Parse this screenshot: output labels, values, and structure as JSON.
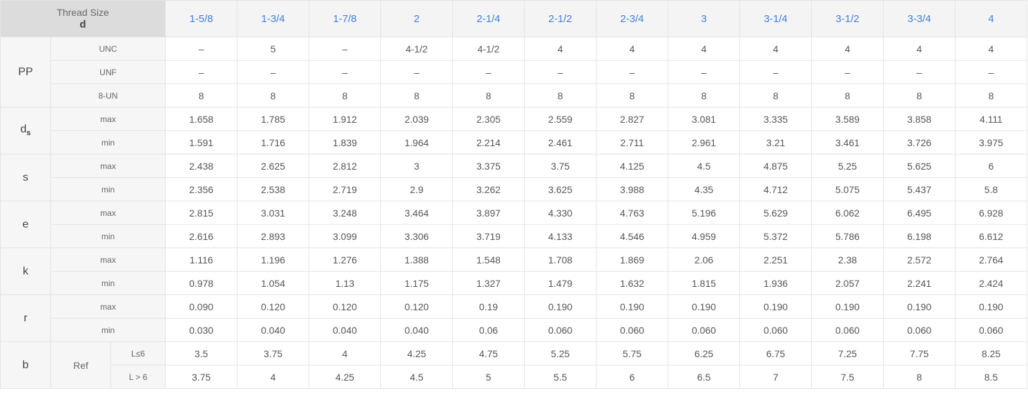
{
  "header": {
    "corner_label": "Thread Size",
    "corner_symbol": "d",
    "sizes": [
      "1-5/8",
      "1-3/4",
      "1-7/8",
      "2",
      "2-1/4",
      "2-1/2",
      "2-3/4",
      "3",
      "3-1/4",
      "3-1/2",
      "3-3/4",
      "4"
    ]
  },
  "rows": [
    {
      "param": "PP",
      "sub": "UNC",
      "values": [
        "–",
        "5",
        "–",
        "4-1/2",
        "4-1/2",
        "4",
        "4",
        "4",
        "4",
        "4",
        "4",
        "4"
      ]
    },
    {
      "sub": "UNF",
      "values": [
        "–",
        "–",
        "–",
        "–",
        "–",
        "–",
        "–",
        "–",
        "–",
        "–",
        "–",
        "–"
      ]
    },
    {
      "sub": "8-UN",
      "values": [
        "8",
        "8",
        "8",
        "8",
        "8",
        "8",
        "8",
        "8",
        "8",
        "8",
        "8",
        "8"
      ]
    },
    {
      "param": "d",
      "param_sub": "s",
      "sub": "max",
      "values": [
        "1.658",
        "1.785",
        "1.912",
        "2.039",
        "2.305",
        "2.559",
        "2.827",
        "3.081",
        "3.335",
        "3.589",
        "3.858",
        "4.111"
      ]
    },
    {
      "sub": "min",
      "values": [
        "1.591",
        "1.716",
        "1.839",
        "1.964",
        "2.214",
        "2.461",
        "2.711",
        "2.961",
        "3.21",
        "3.461",
        "3.726",
        "3.975"
      ]
    },
    {
      "param": "s",
      "sub": "max",
      "values": [
        "2.438",
        "2.625",
        "2.812",
        "3",
        "3.375",
        "3.75",
        "4.125",
        "4.5",
        "4.875",
        "5.25",
        "5.625",
        "6"
      ]
    },
    {
      "sub": "min",
      "values": [
        "2.356",
        "2.538",
        "2.719",
        "2.9",
        "3.262",
        "3.625",
        "3.988",
        "4.35",
        "4.712",
        "5.075",
        "5.437",
        "5.8"
      ]
    },
    {
      "param": "e",
      "sub": "max",
      "values": [
        "2.815",
        "3.031",
        "3.248",
        "3.464",
        "3.897",
        "4.330",
        "4.763",
        "5.196",
        "5.629",
        "6.062",
        "6.495",
        "6.928"
      ]
    },
    {
      "sub": "min",
      "values": [
        "2.616",
        "2.893",
        "3.099",
        "3.306",
        "3.719",
        "4.133",
        "4.546",
        "4.959",
        "5.372",
        "5.786",
        "6.198",
        "6.612"
      ]
    },
    {
      "param": "k",
      "sub": "max",
      "values": [
        "1.116",
        "1.196",
        "1.276",
        "1.388",
        "1.548",
        "1.708",
        "1.869",
        "2.06",
        "2.251",
        "2.38",
        "2.572",
        "2.764"
      ]
    },
    {
      "sub": "min",
      "values": [
        "0.978",
        "1.054",
        "1.13",
        "1.175",
        "1.327",
        "1.479",
        "1.632",
        "1.815",
        "1.936",
        "2.057",
        "2.241",
        "2.424"
      ]
    },
    {
      "param": "r",
      "sub": "max",
      "values": [
        "0.090",
        "0.120",
        "0.120",
        "0.120",
        "0.19",
        "0.190",
        "0.190",
        "0.190",
        "0.190",
        "0.190",
        "0.190",
        "0.190"
      ]
    },
    {
      "sub": "min",
      "values": [
        "0.030",
        "0.040",
        "0.040",
        "0.040",
        "0.06",
        "0.060",
        "0.060",
        "0.060",
        "0.060",
        "0.060",
        "0.060",
        "0.060"
      ]
    },
    {
      "param": "b",
      "sub": "Ref",
      "sub3": "L≤6",
      "values": [
        "3.5",
        "3.75",
        "4",
        "4.25",
        "4.75",
        "5.25",
        "5.75",
        "6.25",
        "6.75",
        "7.25",
        "7.75",
        "8.25"
      ]
    },
    {
      "sub3": "L > 6",
      "values": [
        "3.75",
        "4",
        "4.25",
        "4.5",
        "5",
        "5.5",
        "6",
        "6.5",
        "7",
        "7.5",
        "8",
        "8.5"
      ]
    }
  ]
}
